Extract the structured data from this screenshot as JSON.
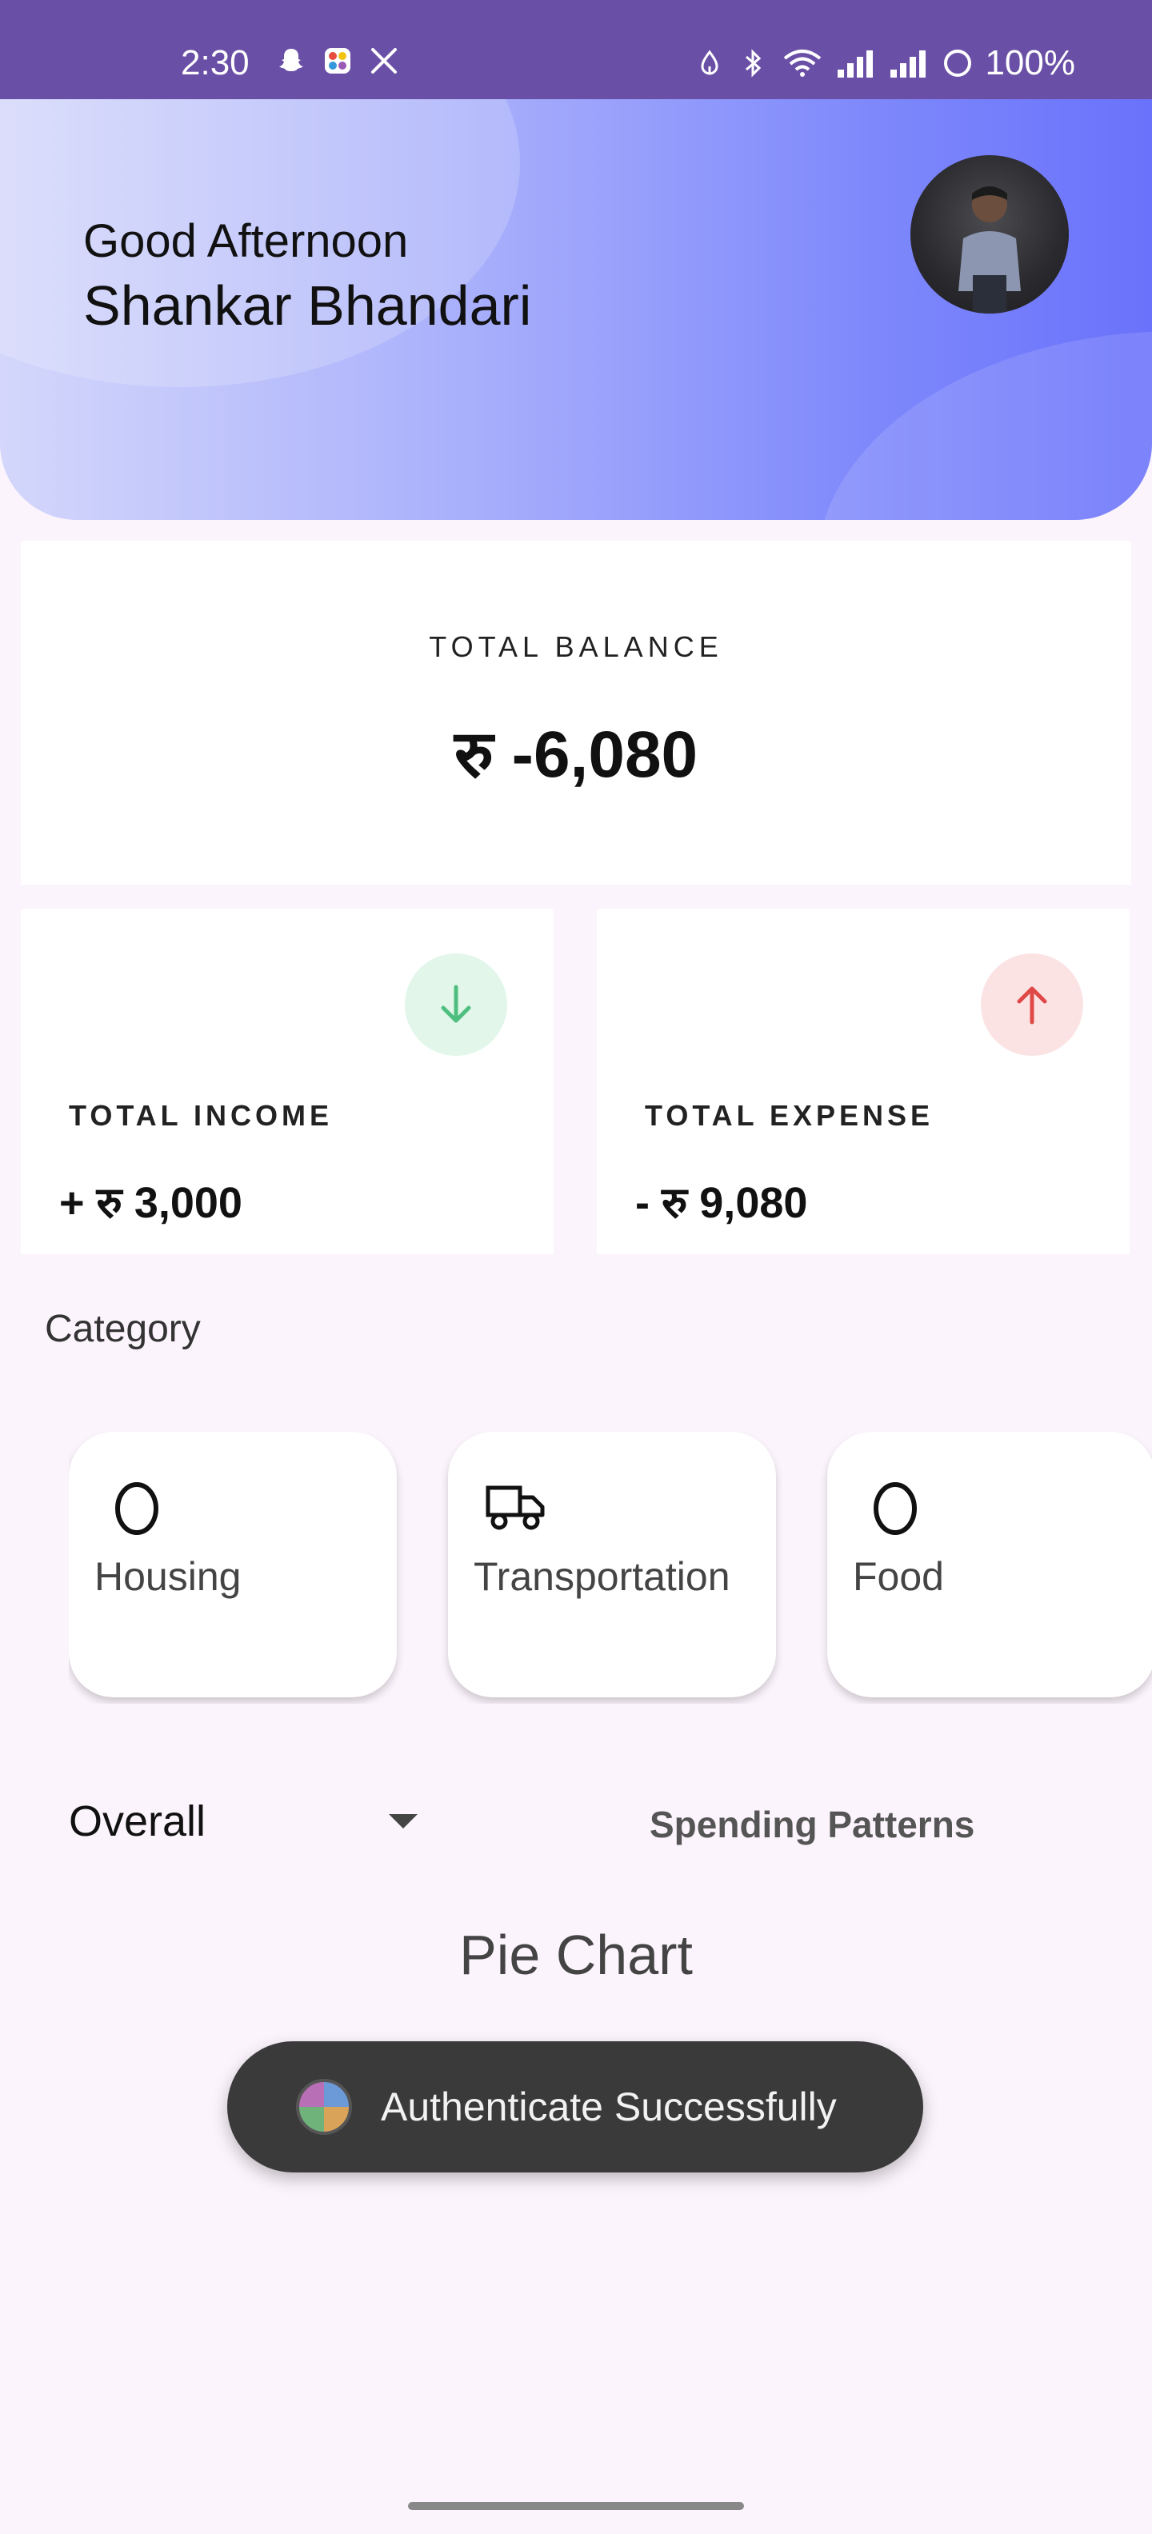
{
  "status_bar": {
    "time": "2:30",
    "battery": "100%",
    "left_icons": [
      "snapchat-icon",
      "app-grid-icon",
      "x-icon"
    ],
    "right_icons": [
      "data-saver-icon",
      "bluetooth-icon",
      "wifi-icon",
      "signal-icon",
      "signal-icon",
      "battery-icon"
    ]
  },
  "header": {
    "greeting": "Good Afternoon",
    "name": "Shankar Bhandari"
  },
  "balance": {
    "label": "TOTAL BALANCE",
    "value": "रु -6,080"
  },
  "income": {
    "label": "TOTAL INCOME",
    "value": "+ रु 3,000",
    "icon": "arrow-down-icon",
    "color": "#4fbf7f"
  },
  "expense": {
    "label": "TOTAL EXPENSE",
    "value": "- रु 9,080",
    "icon": "arrow-up-icon",
    "color": "#e04848"
  },
  "category": {
    "title": "Category",
    "items": [
      {
        "label": "Housing",
        "icon": "egg-icon"
      },
      {
        "label": "Transportation",
        "icon": "truck-icon"
      },
      {
        "label": "Food",
        "icon": "egg-icon"
      }
    ]
  },
  "filters": {
    "selected": "Overall",
    "spending_link": "Spending Patterns"
  },
  "chart": {
    "title": "Pie Chart"
  },
  "toast": {
    "message": "Authenticate Successfully"
  }
}
